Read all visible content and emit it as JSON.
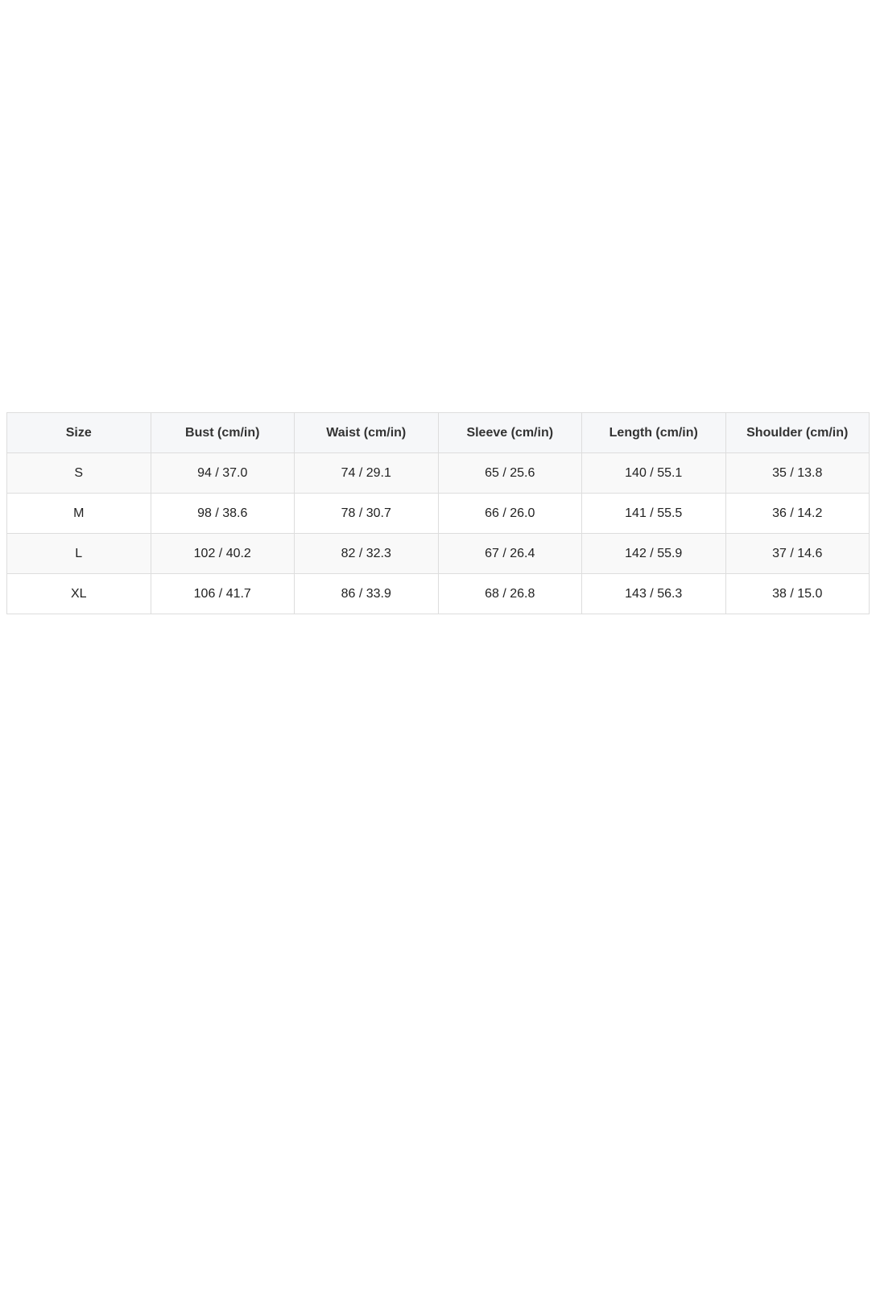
{
  "table": {
    "headers": [
      "Size",
      "Bust (cm/in)",
      "Waist (cm/in)",
      "Sleeve (cm/in)",
      "Length (cm/in)",
      "Shoulder (cm/in)"
    ],
    "rows": [
      [
        "S",
        "94 / 37.0",
        "74 / 29.1",
        "65 / 25.6",
        "140 / 55.1",
        "35 / 13.8"
      ],
      [
        "M",
        "98 / 38.6",
        "78 / 30.7",
        "66 / 26.0",
        "141 / 55.5",
        "36 / 14.2"
      ],
      [
        "L",
        "102 / 40.2",
        "82 / 32.3",
        "67 / 26.4",
        "142 / 55.9",
        "37 / 14.6"
      ],
      [
        "XL",
        "106 / 41.7",
        "86 / 33.9",
        "68 / 26.8",
        "143 / 56.3",
        "38 / 15.0"
      ]
    ]
  }
}
